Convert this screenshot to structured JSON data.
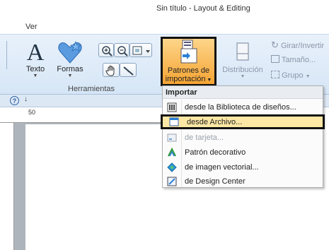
{
  "window": {
    "title": "Sin título - Layout & Editing"
  },
  "tabs": {
    "ver": "Ver"
  },
  "ribbon": {
    "texto_label": "Texto",
    "formas_label": "Formas",
    "herramientas_group": "Herramientas",
    "patrones_label_1": "Patrones de",
    "patrones_label_2": "importación",
    "distribucion_label": "Distribución",
    "girar_label": "Girar/Invertir",
    "tamano_label": "Tamaño...",
    "grupo_label": "Grupo",
    "help_icon": "?",
    "qat_arrow": "↓"
  },
  "ruler": {
    "mark": "50"
  },
  "import_menu": {
    "header": "Importar",
    "items": [
      {
        "label": "desde la Biblioteca de diseños...",
        "icon": "library-icon"
      },
      {
        "label": "desde Archivo...",
        "icon": "file-icon",
        "highlighted": true
      },
      {
        "label": "de tarjeta...",
        "icon": "card-icon",
        "disabled": true
      },
      {
        "label": "Patrón decorativo",
        "icon": "decorative-icon"
      },
      {
        "label": "de imagen vectorial...",
        "icon": "vector-icon"
      },
      {
        "label": "de Design Center",
        "icon": "design-center-icon"
      }
    ]
  },
  "colors": {
    "accent_highlight": "#fde7a4",
    "import_button": "#f5a433",
    "ribbon_bg": "#dce9f7"
  }
}
